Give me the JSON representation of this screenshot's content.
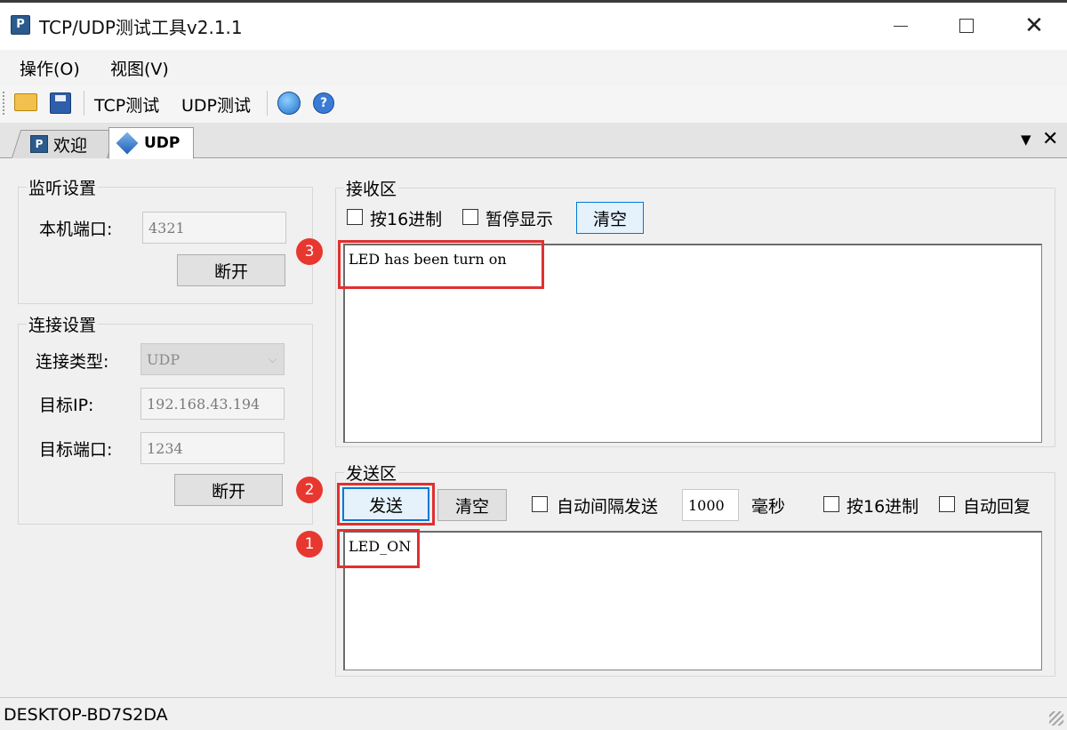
{
  "window": {
    "title": "TCP/UDP测试工具v2.1.1",
    "icon_glyph": "P",
    "controls": {
      "close_glyph": "✕"
    }
  },
  "menu": [
    {
      "label": "操作(O)"
    },
    {
      "label": "视图(V)"
    }
  ],
  "toolbar": {
    "tcp_label": "TCP测试",
    "udp_label": "UDP测试",
    "help_glyph": "?"
  },
  "tabs": [
    {
      "label": "欢迎",
      "icon": "welcome-icon",
      "active": false
    },
    {
      "label": "UDP",
      "icon": "udp-icon",
      "active": true
    }
  ],
  "tab_controls": {
    "dropdown_glyph": "▼",
    "close_glyph": "✕"
  },
  "listen": {
    "title": "监听设置",
    "port_label": "本机端口:",
    "port_value": "4321",
    "disconnect_label": "断开"
  },
  "connection": {
    "title": "连接设置",
    "type_label": "连接类型:",
    "type_value": "UDP",
    "ip_label": "目标IP:",
    "ip_value": "192.168.43.194",
    "port_label": "目标端口:",
    "port_value": "1234",
    "disconnect_label": "断开"
  },
  "receive": {
    "title": "接收区",
    "hex_label": "按16进制",
    "pause_label": "暂停显示",
    "clear_label": "清空",
    "content": "LED has been turn on"
  },
  "send": {
    "title": "发送区",
    "send_label": "发送",
    "clear_label": "清空",
    "auto_interval_label": "自动间隔发送",
    "interval_value": "1000",
    "interval_unit": "毫秒",
    "hex_label": "按16进制",
    "auto_reply_label": "自动回复",
    "content": "LED_ON"
  },
  "annotations": [
    {
      "number": "1"
    },
    {
      "number": "2"
    },
    {
      "number": "3"
    }
  ],
  "status": {
    "host": "DESKTOP-BD7S2DA"
  },
  "colors": {
    "highlight": "#e03030",
    "badge": "#e8372f",
    "accent_border": "#0078d7"
  }
}
